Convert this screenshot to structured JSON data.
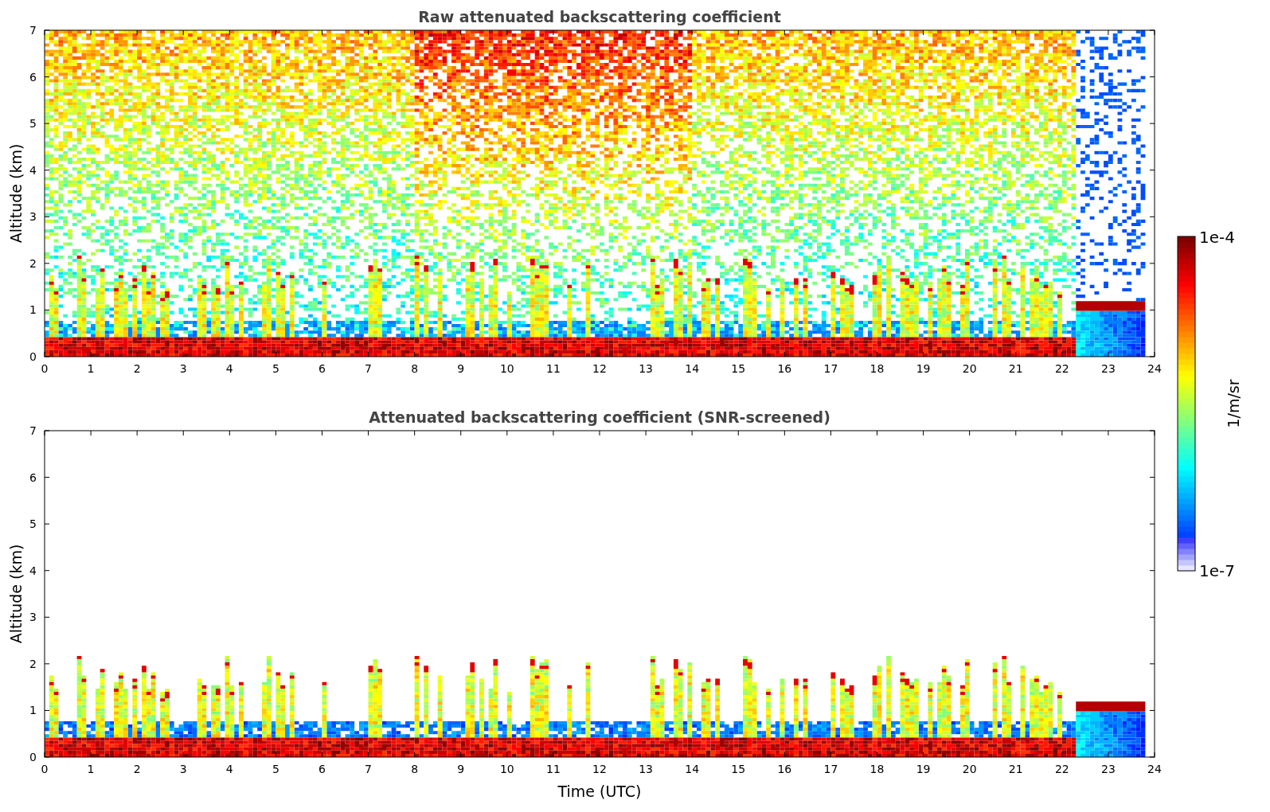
{
  "panels": [
    {
      "kind": "raw",
      "title": "Raw attenuated backscattering coefficient",
      "ylabel": "Altitude (km)",
      "yticks": [
        "7",
        "6",
        "5",
        "4",
        "3",
        "2",
        "1",
        "0"
      ],
      "xticks": [
        "0",
        "1",
        "2",
        "3",
        "4",
        "5",
        "6",
        "7",
        "8",
        "9",
        "10",
        "11",
        "12",
        "13",
        "14",
        "15",
        "16",
        "17",
        "18",
        "19",
        "20",
        "21",
        "22",
        "23",
        "24"
      ]
    },
    {
      "kind": "screened",
      "title": "Attenuated backscattering coefficient (SNR-screened)",
      "ylabel": "Altitude (km)",
      "xlabel": "Time (UTC)",
      "yticks": [
        "7",
        "6",
        "5",
        "4",
        "3",
        "2",
        "1",
        "0"
      ],
      "xticks": [
        "0",
        "1",
        "2",
        "3",
        "4",
        "5",
        "6",
        "7",
        "8",
        "9",
        "10",
        "11",
        "12",
        "13",
        "14",
        "15",
        "16",
        "17",
        "18",
        "19",
        "20",
        "21",
        "22",
        "23",
        "24"
      ]
    }
  ],
  "colorbar": {
    "label": "1/m/sr",
    "max_label": "1e-4",
    "min_label": "1e-7"
  }
}
